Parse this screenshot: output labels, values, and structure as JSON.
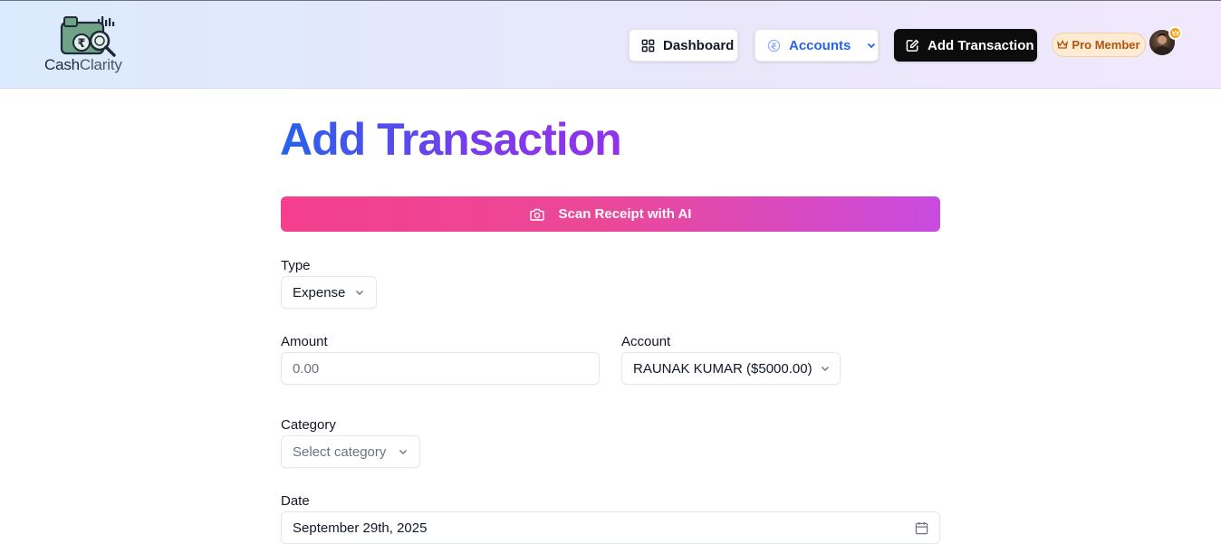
{
  "app": {
    "logo_text_part1": "Cash",
    "logo_text_part2": "Clarity",
    "brand_colors": {
      "primary": "#2563eb",
      "accent": "#9333ea",
      "scan_start": "#f43f8e",
      "scan_end": "#c84be0"
    }
  },
  "nav": {
    "dashboard_label": "Dashboard",
    "accounts_label": "Accounts",
    "add_transaction_label": "Add Transaction",
    "pro_badge_label": "Pro Member",
    "icons": {
      "dashboard": "grid-icon",
      "accounts": "coin-icon",
      "add": "edit-square-icon",
      "pro": "crown-icon"
    }
  },
  "main": {
    "title": "Add Transaction",
    "scan_label": "Scan Receipt with AI",
    "form": {
      "type": {
        "label": "Type",
        "value": "Expense"
      },
      "amount": {
        "label": "Amount",
        "placeholder": "0.00",
        "value": ""
      },
      "account": {
        "label": "Account",
        "value": "RAUNAK KUMAR ($5000.00)"
      },
      "category": {
        "label": "Category",
        "placeholder": "Select category"
      },
      "date": {
        "label": "Date",
        "value": "September 29th, 2025"
      }
    }
  }
}
